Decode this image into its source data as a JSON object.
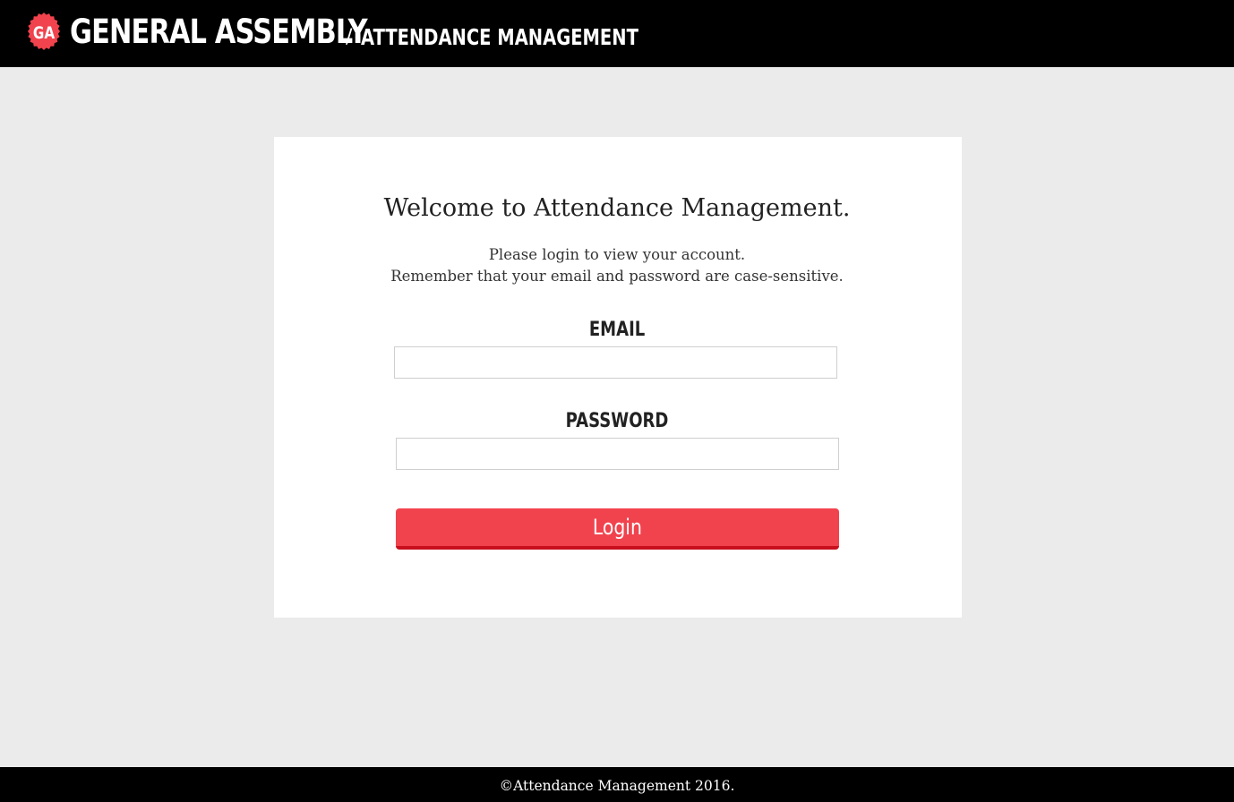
{
  "header": {
    "logo_text": "GA",
    "brand": "GENERAL ASSEMBLY",
    "separator": "/",
    "app_name": "ATTENDANCE MANAGEMENT",
    "background_color": "#000000",
    "logo_color": "#f1434d"
  },
  "login": {
    "welcome": "Welcome to Attendance Management.",
    "message_line1": "Please login to view your account.",
    "message_line2": "Remember that your email and password are case-sensitive.",
    "email_label": "EMAIL",
    "email_value": "",
    "password_label": "PASSWORD",
    "password_value": "",
    "button_label": "Login",
    "button_color": "#f1434d"
  },
  "footer": {
    "text": "©Attendance Management 2016."
  }
}
